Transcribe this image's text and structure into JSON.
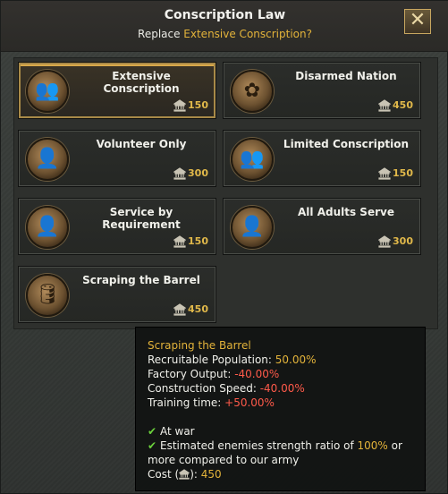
{
  "dialog": {
    "title": "Conscription Law",
    "subtitle_prefix": "Replace ",
    "subtitle_highlight": "Extensive Conscription?",
    "close_label": "✕"
  },
  "cards": [
    {
      "name": "Extensive Conscription",
      "cost": "150",
      "icon": "soldiers-portrait-icon",
      "selected": true
    },
    {
      "name": "Disarmed Nation",
      "cost": "450",
      "icon": "rifle-flower-portrait-icon"
    },
    {
      "name": "Volunteer Only",
      "cost": "300",
      "icon": "volunteer-soldier-portrait-icon"
    },
    {
      "name": "Limited Conscription",
      "cost": "150",
      "icon": "soldiers-portrait-icon"
    },
    {
      "name": "Service by Requirement",
      "cost": "150",
      "icon": "soldier-portrait-icon"
    },
    {
      "name": "All Adults Serve",
      "cost": "300",
      "icon": "soldier-helmet-portrait-icon"
    },
    {
      "name": "Scraping the Barrel",
      "cost": "450",
      "icon": "barrel-soldier-portrait-icon"
    }
  ],
  "tooltip": {
    "title": "Scraping the Barrel",
    "recruitable_label": "Recruitable Population: ",
    "recruitable_value": "50.00%",
    "factory_label": "Factory Output: ",
    "factory_value": "-40.00%",
    "construction_label": "Construction Speed: ",
    "construction_value": "-40.00%",
    "training_label": "Training time: ",
    "training_value": "+50.00%",
    "req1": "At war",
    "req2_prefix": "Estimated enemies strength ratio of ",
    "req2_value": "100%",
    "req2_suffix": " or",
    "req2_line2": "more compared to our army",
    "cost_label": "Cost (",
    "cost_label_end": "): ",
    "cost_value": "450"
  },
  "colors": {
    "accent": "#e3b33a",
    "negative": "#ff5a4a",
    "check": "#6bd13c"
  }
}
